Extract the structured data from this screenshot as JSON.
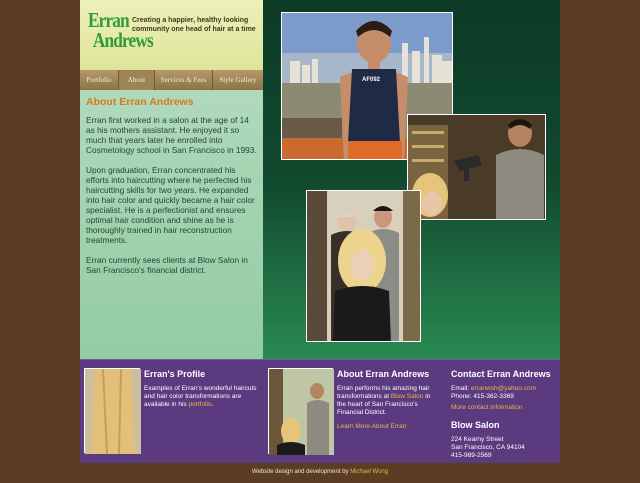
{
  "header": {
    "logo_line1": "Erran",
    "logo_line2": "Andrews",
    "tagline": "Creating a happier, healthy looking community one head of hair at a time"
  },
  "nav": {
    "tabs": [
      {
        "label": "Portfolio"
      },
      {
        "label": "About"
      },
      {
        "label": "Services & Fees"
      },
      {
        "label": "Style Gallery"
      }
    ]
  },
  "main": {
    "title": "About Erran Andrews",
    "paragraphs": [
      "Erran first worked in a salon at the age of 14 as his mothers assistant. He enjoyed it so much that years later he enrolled into Cosmetology school in San Francisco in 1993.",
      "Upon graduation, Erran concentrated his efforts into haircutting where he perfected his haircutting skills for two years. He expanded into hair color and quickly became a hair color specialist. He is a perfectionist and ensures optimal hair condition and shine as he is thoroughly trained in hair reconstruction treatments.",
      "Erran currently sees clients at Blow Salon in San Francisco's financial district."
    ]
  },
  "photos": {
    "shirt_text": "AF092"
  },
  "footer": {
    "profile": {
      "title": "Erran's Profile",
      "text": "Examples of Erran's wonderful haircuts and hair color transformations are available in his",
      "link": "portfolio",
      "end": "."
    },
    "about": {
      "title": "About Erran Andrews",
      "text_start": "Erran performs his amazing hair transformations at",
      "salon_link": "Blow Salon",
      "text_end": "in the heart of San Francisco's Financial District.",
      "learn_more": "Learn More About Erran"
    },
    "contact": {
      "title": "Contact Erran Andrews",
      "email_label": "Email:",
      "email": "erranwsh@yahoo.com",
      "phone": "Phone: 415-362-3369",
      "more_link": "More contact information"
    },
    "salon": {
      "title": "Blow Salon",
      "address1": "224 Kearny Street",
      "address2": "San Francisco, CA 94104",
      "phone": "415-989-2569"
    }
  },
  "credit": {
    "text": "Website design and development by",
    "author": "Michael Wong"
  },
  "colors": {
    "accent_orange": "#d77a1e",
    "link_gold": "#e8b648",
    "footer_purple": "#5c3a80",
    "brown_bg": "#5a3d22"
  }
}
